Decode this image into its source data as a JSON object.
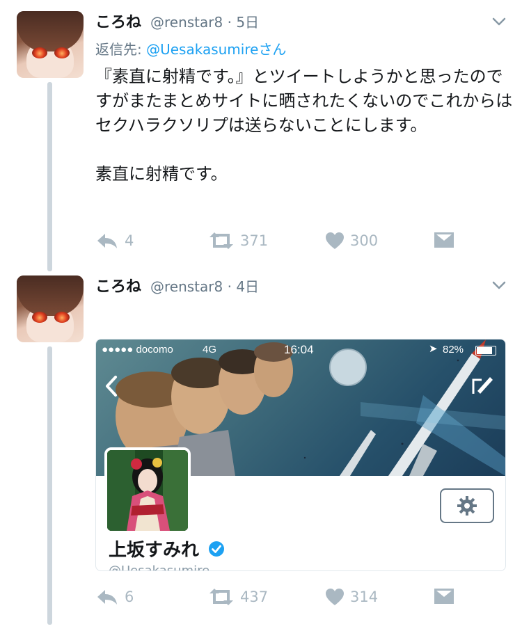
{
  "tweets": [
    {
      "author_name": "ころね",
      "handle": "@renstar8",
      "sep": "·",
      "time": "5日",
      "reply_prefix": "返信先:",
      "reply_mention": "@Uesakasumireさん",
      "text": "『素直に射精です。』とツイートしようかと思ったのですがまたまとめサイトに晒されたくないのでこれからはセクハラクソリプは送らないことにします。\n\n素直に射精です。",
      "replies": "4",
      "retweets": "371",
      "likes": "300"
    },
    {
      "author_name": "ころね",
      "handle": "@renstar8",
      "sep": "·",
      "time": "4日",
      "replies": "6",
      "retweets": "437",
      "likes": "314"
    }
  ],
  "card": {
    "carrier": "●●●●● docomo",
    "network": "4G",
    "clock": "16:04",
    "battery": "82%",
    "profile_name": "上坂すみれ",
    "profile_handle": "@Uesakasumire"
  },
  "icons": [
    "reply-icon",
    "retweet-icon",
    "heart-icon",
    "dm-icon",
    "chevron-down-icon",
    "back-chevron-icon",
    "compose-icon",
    "gear-icon",
    "verified-badge-icon"
  ],
  "colors": {
    "accent": "#1da1f2",
    "muted": "#aab8c2",
    "thread_line": "#cdd6dd",
    "verified": "#1da1f2"
  }
}
